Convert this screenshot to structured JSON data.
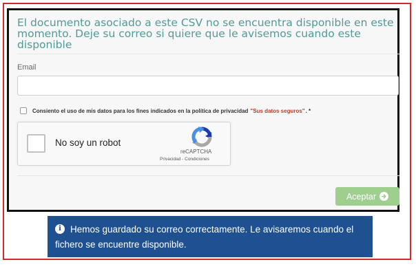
{
  "panel": {
    "title": "El documento asociado a este CSV no se encuentra disponible en este momento. Deje su correo si quiere que le avisemos cuando este disponible",
    "email_label": "Email",
    "email_value": "",
    "consent": {
      "text": "Consiento el uso de mis datos para los fines indicados en la política de privacidad",
      "link": "\"Sus datos seguros\"",
      "suffix": ". *",
      "checked": false
    },
    "captcha": {
      "label": "No soy un robot",
      "brand": "reCAPTCHA",
      "terms": "Privacidad - Condiciones",
      "checked": false
    },
    "accept_label": "Aceptar"
  },
  "notice": {
    "icon": "info-icon",
    "text": "Hemos guardado su correo correctamente. Le avisaremos cuando el fichero se encuentre disponible."
  },
  "colors": {
    "title": "#4f9a9a",
    "accept_button": "#9fcf8f",
    "notice_bg": "#1f5191",
    "consent_link": "#c0392b",
    "highlight_red": "#d2282e"
  }
}
